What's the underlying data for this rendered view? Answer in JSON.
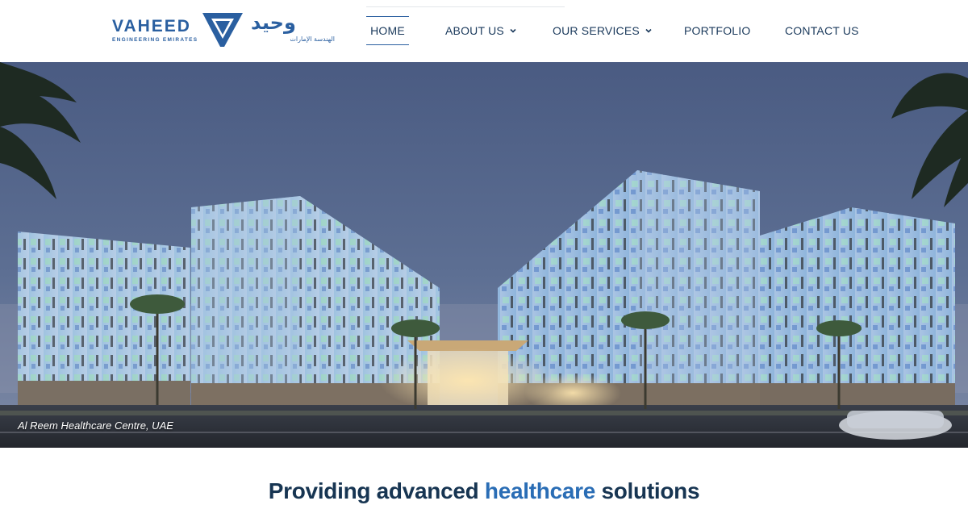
{
  "brand": {
    "name_en": "VAHEED",
    "tagline_en": "ENGINEERING EMIRATES",
    "name_ar": "وحيد",
    "tagline_ar": "الهندسة الإمارات",
    "color": "#2a5fa0"
  },
  "nav": {
    "items": [
      {
        "label": "HOME",
        "active": true
      },
      {
        "label": "ABOUT US",
        "has_dropdown": true
      },
      {
        "label": "OUR SERVICES",
        "has_dropdown": true
      },
      {
        "label": "PORTFOLIO"
      },
      {
        "label": "CONTACT US"
      }
    ]
  },
  "hero": {
    "caption": "Al Reem Healthcare Centre, UAE",
    "sky_color": "#4a5f86"
  },
  "headline": {
    "part1": "Providing advanced ",
    "highlight": "healthcare",
    "part2": " solutions",
    "text_color": "#173552",
    "highlight_color": "#2a6db5"
  }
}
